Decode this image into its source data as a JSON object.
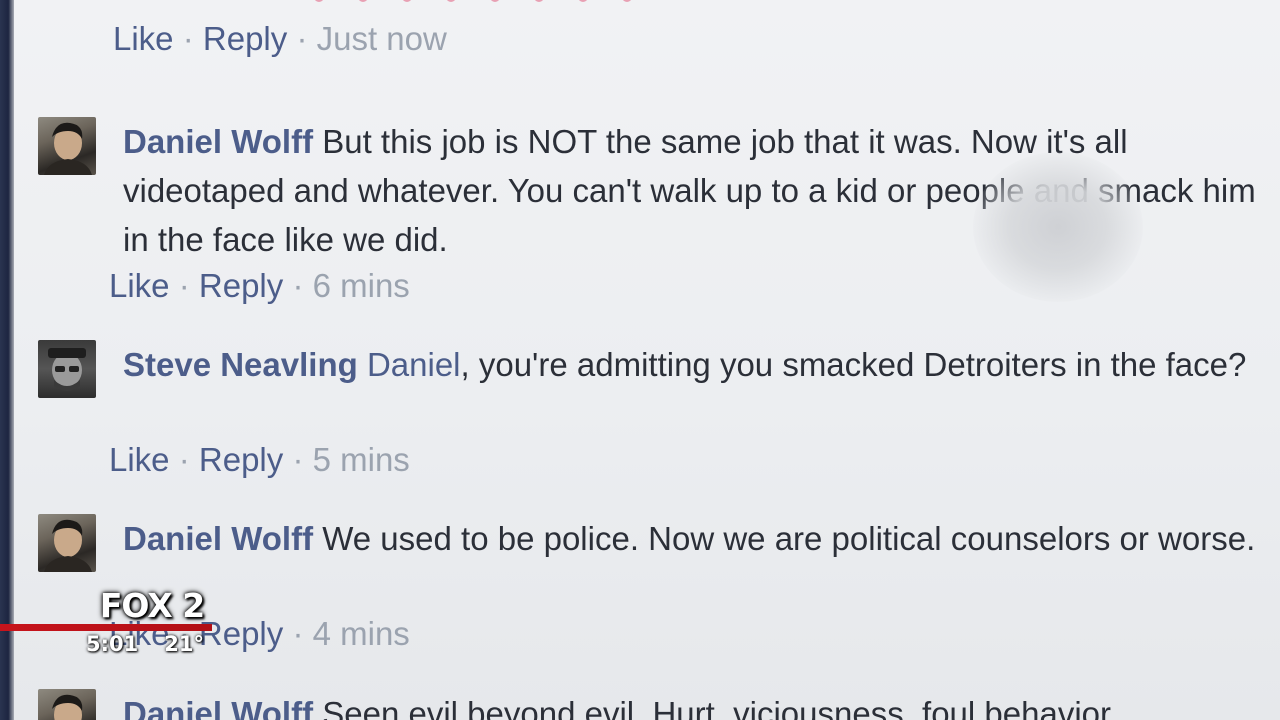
{
  "top_actions": {
    "like": "Like",
    "reply": "Reply",
    "separator": "·",
    "time": "Just now"
  },
  "comments": [
    {
      "author": "Daniel Wolff",
      "text": "But this job is NOT the same job that it was. Now it's all videotaped and whatever. You can't walk up to a kid or people and smack him in the face like we did.",
      "like": "Like",
      "reply": "Reply",
      "time": "6 mins"
    },
    {
      "author": "Steve Neavling",
      "mention": "Daniel",
      "text": ", you're admitting you smacked Detroiters in the face?",
      "like": "Like",
      "reply": "Reply",
      "time": "5 mins"
    },
    {
      "author": "Daniel Wolff",
      "text": "We used to be police. Now we are political counselors or worse.",
      "like": "Like",
      "reply": "Reply",
      "time": "4 mins"
    },
    {
      "author": "Daniel Wolff",
      "text": "Seen evil beyond evil. Hurt, viciousness, foul behavior"
    }
  ],
  "tv_overlay": {
    "logo": "FOX 2",
    "time": "5:01",
    "temperature": "21°"
  },
  "colors": {
    "link": "#4c5d8a",
    "text": "#2b2f38",
    "meta": "#9ba3af",
    "brand_red": "#c7141c"
  }
}
